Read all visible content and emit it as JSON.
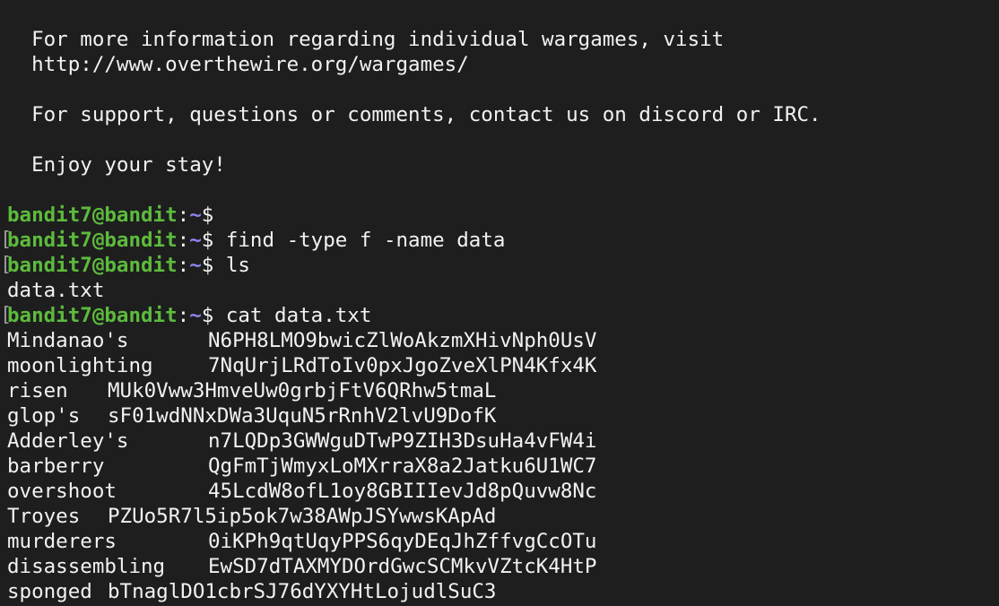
{
  "motd": {
    "line1": "For more information regarding individual wargames, visit",
    "line2": "http://www.overthewire.org/wargames/",
    "line3": "For support, questions or comments, contact us on discord or IRC.",
    "line4": "Enjoy your stay!"
  },
  "prompt": {
    "user_host": "bandit7@bandit",
    "separator": ":",
    "path": "~",
    "symbol": "$",
    "user_color": "#5dbb3d",
    "path_color": "#8c85f0"
  },
  "commands": [
    "",
    "find -type f -name data",
    "ls",
    "cat data.txt"
  ],
  "ls_output": "data.txt",
  "file_rows": [
    {
      "word": "Mindanao's",
      "value": "N6PH8LMO9bwicZlWoAkzmXHivNph0UsV"
    },
    {
      "word": "moonlighting",
      "value": "7NqUrjLRdToIv0pxJgoZveXlPN4Kfx4K"
    },
    {
      "word": "risen",
      "value": "MUk0Vww3HmveUw0grbjFtV6QRhw5tmaL"
    },
    {
      "word": "glop's",
      "value": "sF01wdNNxDWa3UquN5rRnhV2lvU9DofK"
    },
    {
      "word": "Adderley's",
      "value": "n7LQDp3GWWguDTwP9ZIH3DsuHa4vFW4i"
    },
    {
      "word": "barberry",
      "value": "QgFmTjWmyxLoMXrraX8a2Jatku6U1WC7"
    },
    {
      "word": "overshoot",
      "value": "45LcdW8ofL1oy8GBIIIevJd8pQuvw8Nc"
    },
    {
      "word": "Troyes",
      "value": "PZUo5R7l5ip5ok7w38AWpJSYwwsKApAd"
    },
    {
      "word": "murderers",
      "value": "0iKPh9qtUqyPPS6qyDEqJhZffvgCcOTu"
    },
    {
      "word": "disassembling",
      "value": "EwSD7dTAXMYDOrdGwcSCMkvVZtcK4HtP"
    },
    {
      "word": "sponged",
      "value": "bTnaglDO1cbrSJ76dYXYHtLojudlSuC3"
    }
  ],
  "terminal_bg": "#1e1e1e"
}
